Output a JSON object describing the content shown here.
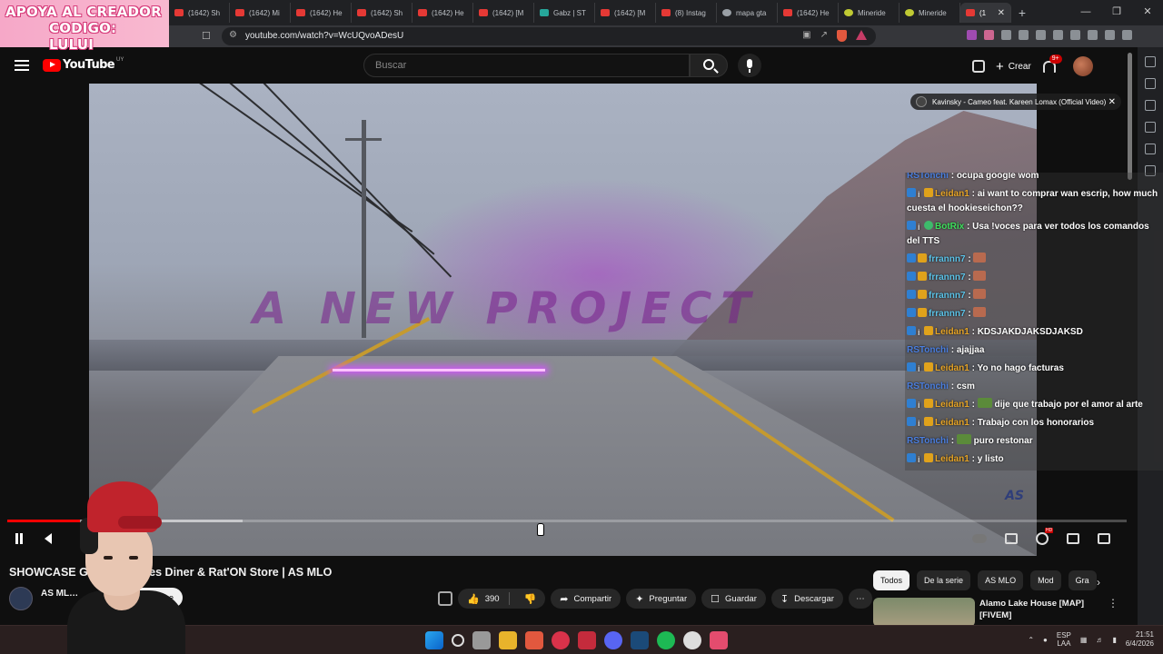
{
  "promo": {
    "line1": "APOYA AL CREADOR",
    "line2": "CODIGO: LULUI"
  },
  "browser": {
    "tabs": [
      {
        "label": "(1642) Sh",
        "fav": "red"
      },
      {
        "label": "(1642) Mi",
        "fav": "red"
      },
      {
        "label": "(1642) He",
        "fav": "red"
      },
      {
        "label": "(1642) Sh",
        "fav": "red"
      },
      {
        "label": "(1642) He",
        "fav": "red"
      },
      {
        "label": "(1642) [M",
        "fav": "red"
      },
      {
        "label": "Gabz | ST",
        "fav": "teal"
      },
      {
        "label": "(1642) [M",
        "fav": "red"
      },
      {
        "label": "(8) Instag",
        "fav": "red"
      },
      {
        "label": "mapa gta",
        "fav": "gray"
      },
      {
        "label": "(1642) He",
        "fav": "red"
      },
      {
        "label": "Mineride",
        "fav": "yellow"
      },
      {
        "label": "Mineride",
        "fav": "yellow"
      }
    ],
    "active_tab": {
      "label": "(1"
    },
    "url": "youtube.com/watch?v=WcUQvoADesU"
  },
  "youtube": {
    "logo_text": "YouTube",
    "country_code": "UY",
    "search_placeholder": "Buscar",
    "create_label": "Crear",
    "notifications_badge": "9+"
  },
  "player": {
    "overlay_text": "A NEW PROJECT",
    "now_playing": "Kavinsky - Cameo feat. Kareen Lomax (Official Video)",
    "progress_played": 0.065,
    "progress_buffered": 0.21,
    "watermark": "AS"
  },
  "chat": [
    {
      "user": "RSTonchi",
      "color": "rs",
      "badges": [],
      "text": "ocupa google wom",
      "cut": true
    },
    {
      "user": "Leidan1",
      "color": "lei",
      "badges": [
        "b",
        "i",
        "y"
      ],
      "text": "ai want to comprar wan escrip, how much cuesta el hookieseichon??"
    },
    {
      "user": "BotRix",
      "color": "bot",
      "badges": [
        "b",
        "i",
        "g"
      ],
      "text": "Usa !voces para ver todos los comandos del TTS"
    },
    {
      "user": "frrannn7",
      "color": "fr",
      "badges": [
        "b",
        "y"
      ],
      "text": "",
      "emote": true
    },
    {
      "user": "frrannn7",
      "color": "fr",
      "badges": [
        "b",
        "y"
      ],
      "text": "",
      "emote": true
    },
    {
      "user": "frrannn7",
      "color": "fr",
      "badges": [
        "b",
        "y"
      ],
      "text": "",
      "emote": true
    },
    {
      "user": "frrannn7",
      "color": "fr",
      "badges": [
        "b",
        "y"
      ],
      "text": "",
      "emote": true
    },
    {
      "user": "Leidan1",
      "color": "lei",
      "badges": [
        "b",
        "i",
        "y"
      ],
      "text": "KDSJAKDJAKSDJAKSD"
    },
    {
      "user": "RSTonchi",
      "color": "rs",
      "badges": [],
      "text": "ajajjaa"
    },
    {
      "user": "Leidan1",
      "color": "lei",
      "badges": [
        "b",
        "i",
        "y"
      ],
      "text": "Yo no hago facturas"
    },
    {
      "user": "RSTonchi",
      "color": "rs",
      "badges": [],
      "text": "csm"
    },
    {
      "user": "Leidan1",
      "color": "lei",
      "badges": [
        "b",
        "i",
        "y"
      ],
      "text": "dije que trabajo por el amor al arte",
      "emote_green": true
    },
    {
      "user": "Leidan1",
      "color": "lei",
      "badges": [
        "b",
        "i",
        "y"
      ],
      "text": "Trabajo con los honorarios"
    },
    {
      "user": "RSTonchi",
      "color": "rs",
      "badges": [],
      "text": "puro restonar",
      "emote_green": true
    },
    {
      "user": "Leidan1",
      "color": "lei",
      "badges": [
        "b",
        "i",
        "y"
      ],
      "text": "y listo"
    }
  ],
  "video": {
    "title": "SHOWCASE G…or: Hookies Diner & Rat'ON Store | AS MLO",
    "channel": "AS ML…",
    "subscribe_label": "…cribirme",
    "likes": "390",
    "share_label": "Compartir",
    "ask_label": "Preguntar",
    "save_label": "Guardar",
    "download_label": "Descargar"
  },
  "sidebar": {
    "chips": [
      "Todos",
      "De la serie",
      "AS MLO",
      "Mod",
      "Gra"
    ],
    "recommendation": {
      "title": "Alamo Lake House [MAP] [FIVEM]"
    }
  },
  "taskbar": {
    "lang_line1": "ESP",
    "lang_line2": "LAA",
    "time": "21:51",
    "date": "6/4/2026"
  }
}
